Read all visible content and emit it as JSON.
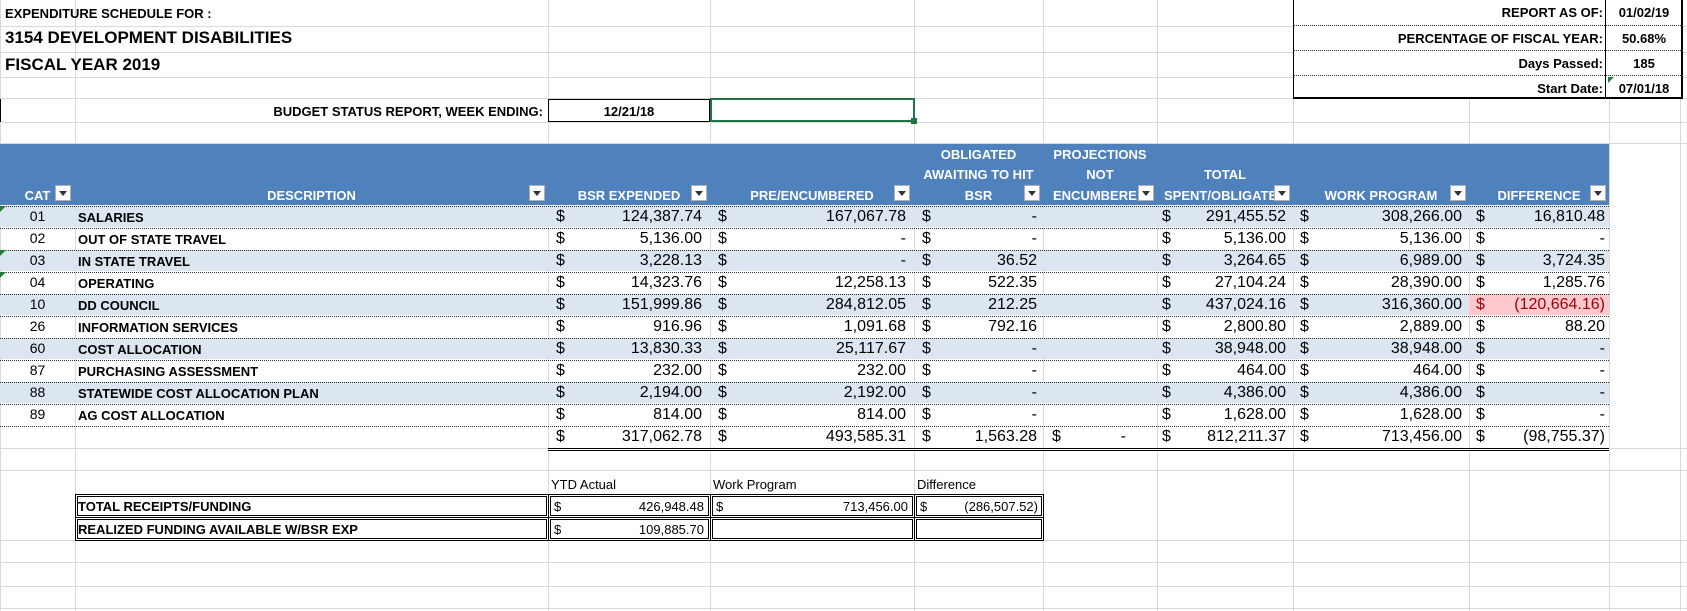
{
  "header": {
    "schedule_label": "EXPENDITURE SCHEDULE FOR :",
    "department": "3154 DEVELOPMENT DISABILITIES",
    "fiscal_year": "FISCAL YEAR 2019",
    "bsr_label": "BUDGET STATUS REPORT, WEEK ENDING:",
    "week_ending": "12/21/18"
  },
  "report_info": [
    {
      "label": "REPORT AS OF:",
      "value": "01/02/19"
    },
    {
      "label": "PERCENTAGE OF FISCAL YEAR:",
      "value": "50.68%"
    },
    {
      "label": "Days Passed:",
      "value": "185"
    },
    {
      "label": "Start Date:",
      "value": "07/01/18"
    }
  ],
  "columns": {
    "cat": "CAT",
    "description": "DESCRIPTION",
    "bsr_expended": "BSR EXPENDED",
    "pre_encumbered": "PRE/ENCUMBERED",
    "obligated_1": "OBLIGATED",
    "obligated_2": "AWAITING TO HIT",
    "obligated_3": "BSR",
    "projections_1": "PROJECTIONS",
    "projections_2": "NOT",
    "projections_3": "ENCUMBERE",
    "total_1": "TOTAL",
    "total_2": "SPENT/OBLIGATE",
    "work_program": "WORK PROGRAM",
    "difference": "DIFFERENCE"
  },
  "currency_symbol": "$",
  "rows": [
    {
      "cat": "01",
      "desc": "SALARIES",
      "bsr": "124,387.74",
      "pre": "167,067.78",
      "obl": "-",
      "total": "291,455.52",
      "wp": "308,266.00",
      "diff": "16,810.48"
    },
    {
      "cat": "02",
      "desc": "OUT OF STATE TRAVEL",
      "bsr": "5,136.00",
      "pre": "-",
      "obl": "-",
      "total": "5,136.00",
      "wp": "5,136.00",
      "diff": "-"
    },
    {
      "cat": "03",
      "desc": "IN STATE TRAVEL",
      "bsr": "3,228.13",
      "pre": "-",
      "obl": "36.52",
      "total": "3,264.65",
      "wp": "6,989.00",
      "diff": "3,724.35"
    },
    {
      "cat": "04",
      "desc": "OPERATING",
      "bsr": "14,323.76",
      "pre": "12,258.13",
      "obl": "522.35",
      "total": "27,104.24",
      "wp": "28,390.00",
      "diff": "1,285.76"
    },
    {
      "cat": "10",
      "desc": "DD COUNCIL",
      "bsr": "151,999.86",
      "pre": "284,812.05",
      "obl": "212.25",
      "total": "437,024.16",
      "wp": "316,360.00",
      "diff": "(120,664.16)"
    },
    {
      "cat": "26",
      "desc": "INFORMATION SERVICES",
      "bsr": "916.96",
      "pre": "1,091.68",
      "obl": "792.16",
      "total": "2,800.80",
      "wp": "2,889.00",
      "diff": "88.20"
    },
    {
      "cat": "60",
      "desc": "COST ALLOCATION",
      "bsr": "13,830.33",
      "pre": "25,117.67",
      "obl": "-",
      "total": "38,948.00",
      "wp": "38,948.00",
      "diff": "-"
    },
    {
      "cat": "87",
      "desc": "PURCHASING ASSESSMENT",
      "bsr": "232.00",
      "pre": "232.00",
      "obl": "-",
      "total": "464.00",
      "wp": "464.00",
      "diff": "-"
    },
    {
      "cat": "88",
      "desc": "STATEWIDE COST ALLOCATION PLAN",
      "bsr": "2,194.00",
      "pre": "2,192.00",
      "obl": "-",
      "total": "4,386.00",
      "wp": "4,386.00",
      "diff": "-"
    },
    {
      "cat": "89",
      "desc": "AG COST ALLOCATION",
      "bsr": "814.00",
      "pre": "814.00",
      "obl": "-",
      "total": "1,628.00",
      "wp": "1,628.00",
      "diff": "-"
    }
  ],
  "totals": {
    "bsr": "317,062.78",
    "pre": "493,585.31",
    "obl": "1,563.28",
    "proj": "-",
    "total": "812,211.37",
    "wp": "713,456.00",
    "diff": "(98,755.37)"
  },
  "summary": {
    "headers": {
      "ytd": "YTD Actual",
      "wp": "Work Program",
      "diff": "Difference"
    },
    "rows": [
      {
        "label": "TOTAL RECEIPTS/FUNDING",
        "ytd": "426,948.48",
        "wp": "713,456.00",
        "diff": "(286,507.52)"
      },
      {
        "label": "REALIZED FUNDING AVAILABLE W/BSR EXP",
        "ytd": "109,885.70",
        "wp": "",
        "diff": ""
      }
    ]
  },
  "colors": {
    "header_blue": "#4f81bd",
    "band": "#dce6f1",
    "negative_bg": "#ffc7ce",
    "negative_text": "#9c0006"
  }
}
